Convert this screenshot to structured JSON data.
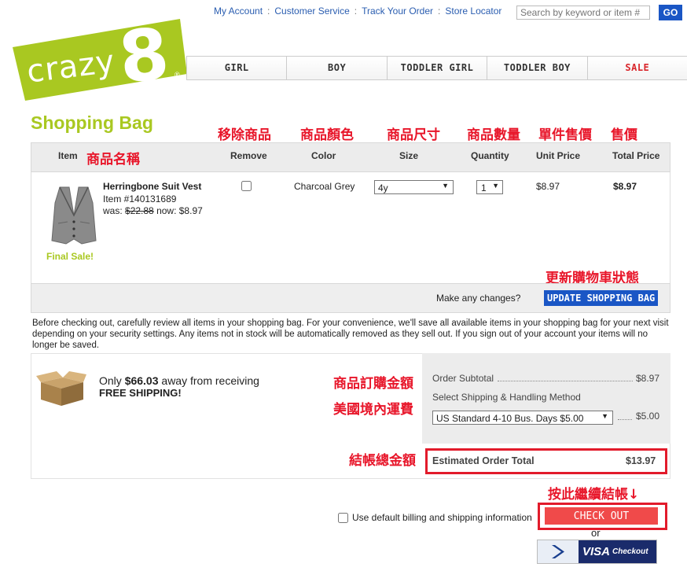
{
  "header": {
    "links": [
      "My Account",
      "Customer Service",
      "Track Your Order",
      "Store Locator"
    ],
    "search_placeholder": "Search by keyword or item #",
    "go_label": "GO"
  },
  "logo": {
    "text": "crazy",
    "numeral": "8",
    "registered": "®"
  },
  "nav": [
    "GIRL",
    "BOY",
    "TODDLER GIRL",
    "TODDLER BOY",
    "SALE"
  ],
  "page_title": "Shopping Bag",
  "annotations": {
    "remove": "移除商品",
    "color": "商品顏色",
    "size": "商品尺寸",
    "quantity": "商品數量",
    "unit_price": "單件售價",
    "total_price": "售價",
    "item_name": "商品名稱",
    "update": "更新購物車狀態",
    "subtotal": "商品訂購金額",
    "shipping": "美國境內運費",
    "order_total": "結帳總金額",
    "checkout": "按此繼續結帳↓"
  },
  "columns": {
    "item": "Item",
    "remove": "Remove",
    "color": "Color",
    "size": "Size",
    "quantity": "Quantity",
    "unit_price": "Unit Price",
    "total_price": "Total Price"
  },
  "item": {
    "name": "Herringbone Suit Vest",
    "item_number": "Item #140131689",
    "was_label": "was:",
    "was_price": "$22.88",
    "now_label": "now: $8.97",
    "final_sale": "Final Sale!",
    "color": "Charcoal Grey",
    "size": "4y",
    "quantity": "1",
    "unit_price": "$8.97",
    "total_price": "$8.97"
  },
  "update_row": {
    "prompt": "Make any changes?",
    "button": "UPDATE SHOPPING BAG"
  },
  "notice": "Before checking out, carefully review all items in your shopping bag. For your convenience, we'll save all available items in your shopping bag for your next visit depending on your security settings. Any items not in stock will be automatically removed as they sell out. If you sign out of your account your items will no longer be saved.",
  "free_shipping": {
    "prefix": "Only ",
    "amount": "$66.03",
    "suffix": " away from receiving",
    "line2": "FREE SHIPPING!"
  },
  "summary": {
    "subtotal_label": "Order Subtotal",
    "subtotal_value": "$8.97",
    "shipping_label": "Select Shipping & Handling Method",
    "shipping_option": "US Standard 4-10 Bus. Days $5.00",
    "shipping_value": "$5.00",
    "total_label": "Estimated Order Total",
    "total_value": "$13.97"
  },
  "checkout": {
    "default_billing_label": "Use default billing and shipping information",
    "button": "CHECK OUT",
    "or": "or",
    "visa": "VISA",
    "visa_suffix": "Checkout"
  },
  "colors": {
    "accent_red": "#e8162a",
    "brand_blue": "#1a56c5",
    "logo_green": "#a9c821"
  }
}
